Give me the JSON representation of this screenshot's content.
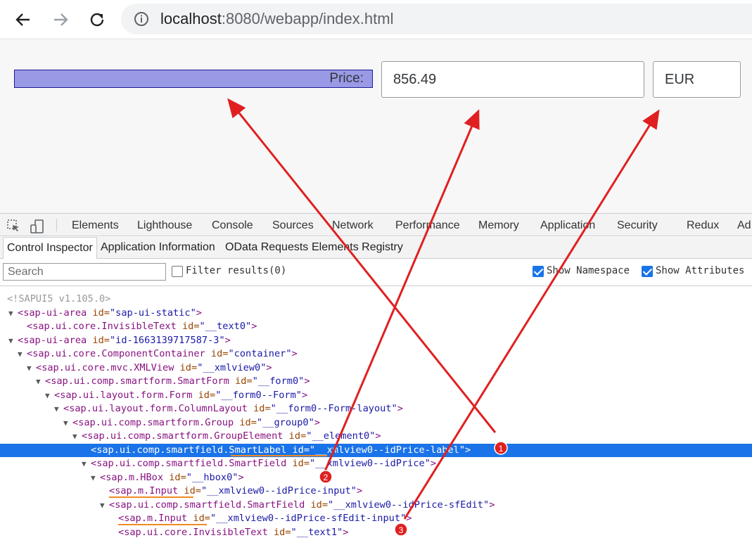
{
  "browser": {
    "url_host": "localhost",
    "url_rest": ":8080/webapp/index.html"
  },
  "app": {
    "price_label": "Price:",
    "price_value": "856.49",
    "currency_value": "EUR"
  },
  "devtools": {
    "tabs": [
      "Elements",
      "Lighthouse",
      "Console",
      "Sources",
      "Network",
      "Performance",
      "Memory",
      "Application",
      "Security",
      "Redux",
      "Ad"
    ],
    "ui5_tabs": [
      "Control Inspector",
      "Application Information",
      "OData Requests",
      "Elements Registry"
    ],
    "search_placeholder": "Search",
    "filter_label": "Filter results(0)",
    "show_namespace_label": "Show Namespace",
    "show_attributes_label": "Show Attributes",
    "version_comment": "<!SAPUI5 v1.105.0>"
  },
  "tree": [
    {
      "tag": "sap-ui-area",
      "id": "sap-ui-static"
    },
    {
      "tag": "sap.ui.core.InvisibleText",
      "id": "__text0"
    },
    {
      "tag": "sap-ui-area",
      "id": "id-1663139717587-3"
    },
    {
      "tag": "sap.ui.core.ComponentContainer",
      "id": "container"
    },
    {
      "tag": "sap.ui.core.mvc.XMLView",
      "id": "__xmlview0"
    },
    {
      "tag": "sap.ui.comp.smartform.SmartForm",
      "id": "__form0"
    },
    {
      "tag": "sap.ui.layout.form.Form",
      "id": "__form0--Form"
    },
    {
      "tag": "sap.ui.layout.form.ColumnLayout",
      "id": "__form0--Form-layout"
    },
    {
      "tag": "sap.ui.comp.smartform.Group",
      "id": "__group0"
    },
    {
      "tag": "sap.ui.comp.smartform.GroupElement",
      "id": "__element0"
    },
    {
      "tag": "sap.ui.comp.smartfield.SmartLabel",
      "id": "__xmlview0--idPrice-label"
    },
    {
      "tag": "sap.ui.comp.smartfield.SmartField",
      "id": "__xmlview0--idPrice"
    },
    {
      "tag": "sap.m.HBox",
      "id": "__hbox0"
    },
    {
      "tag": "sap.m.Input",
      "id": "__xmlview0--idPrice-input"
    },
    {
      "tag": "sap.ui.comp.smartfield.SmartField",
      "id": "__xmlview0--idPrice-sfEdit"
    },
    {
      "tag": "sap.m.Input",
      "id": "__xmlview0--idPrice-sfEdit-input"
    },
    {
      "tag": "sap.ui.core.InvisibleText",
      "id": "__text1"
    }
  ],
  "markers": [
    "1",
    "2",
    "3"
  ],
  "colors": {
    "selection": "#1a73e8",
    "label_highlight": "#9999e6",
    "annotation_arrow": "#e02020",
    "underline": "#f08a24"
  },
  "icons": [
    "back-arrow-icon",
    "forward-arrow-icon",
    "reload-icon",
    "info-icon",
    "inspect-icon",
    "device-toolbar-icon",
    "checkbox-icon"
  ]
}
